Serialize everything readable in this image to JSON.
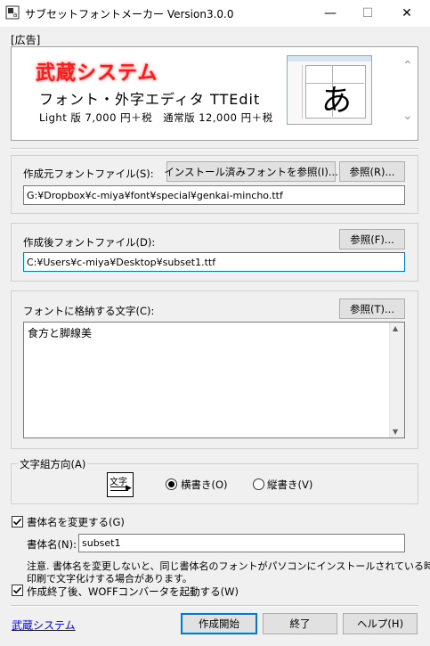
{
  "window": {
    "title": "サブセットフォントメーカー Version3.0.0",
    "minimize": "—",
    "maximize": "☐",
    "close": "✕"
  },
  "ad": {
    "label": "[広告]",
    "brand": "武蔵システム",
    "title": "フォント・外字エディタ TTEdit",
    "price": "Light 版 7,000 円＋税　通常版 12,000 円＋税",
    "thumb_char": "あ"
  },
  "source": {
    "label": "作成元フォントファイル(S):",
    "installed_button": "インストール済みフォントを参照(I)...",
    "browse_button": "参照(R)...",
    "value": "G:¥Dropbox¥c-miya¥font¥special¥genkai-mincho.ttf"
  },
  "output": {
    "label": "作成後フォントファイル(D):",
    "browse_button": "参照(F)...",
    "value": "C:¥Users¥c-miya¥Desktop¥subset1.ttf"
  },
  "chars": {
    "label": "フォントに格納する文字(C):",
    "browse_button": "参照(T)...",
    "value": "食方と脚線美"
  },
  "direction": {
    "label": "文字組方向(A)",
    "icon_text": "文字",
    "horizontal": "横書き(O)",
    "vertical": "縦書き(V)",
    "selected": "horizontal"
  },
  "rename": {
    "checkbox_label": "書体名を変更する(G)",
    "checked": true,
    "name_label": "書体名(N):",
    "name_value": "subset1",
    "note_line1": "注意. 書体名を変更しないと、同じ書体名のフォントがパソコンにインストールされている時、",
    "note_line2": "印刷で文字化けする場合があります。"
  },
  "woff": {
    "checkbox_label": "作成終了後、WOFFコンバータを起動する(W)",
    "checked": true
  },
  "footer": {
    "link": "武蔵システム",
    "create_button": "作成開始",
    "exit_button": "終了",
    "help_button": "ヘルプ(H)"
  }
}
